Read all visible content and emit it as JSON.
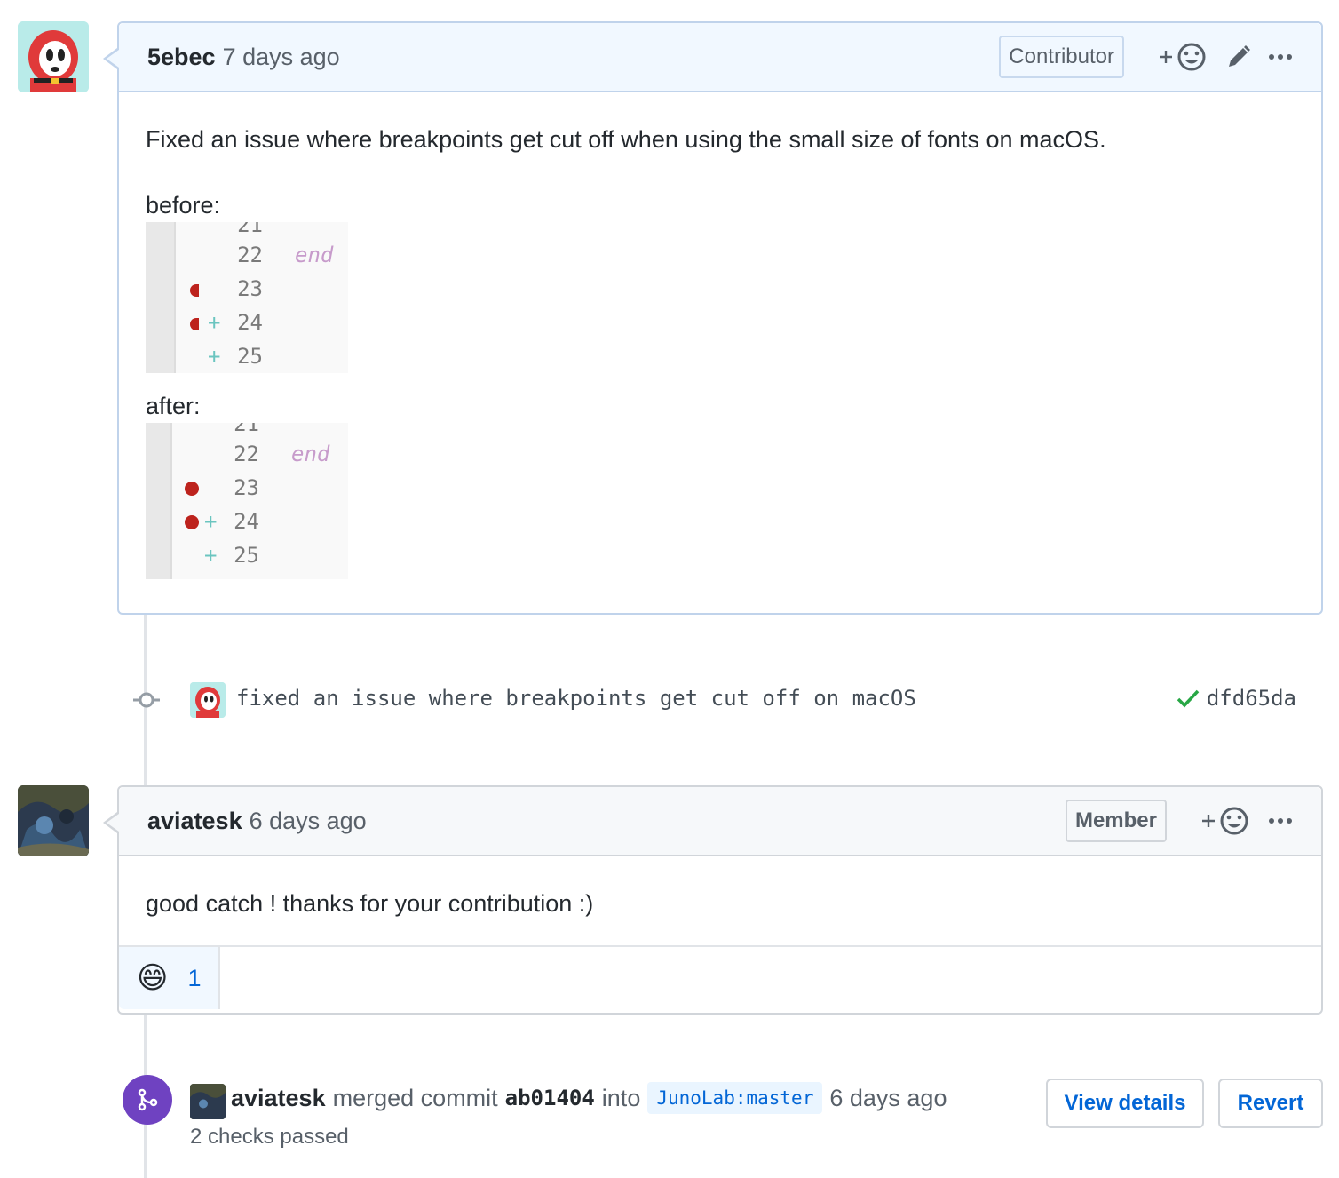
{
  "comments": [
    {
      "author": "5ebec",
      "time": "7 days ago",
      "role": "Contributor",
      "body_line1": "Fixed an issue where breakpoints get cut off when using the small size of fonts on macOS.",
      "label_before": "before:",
      "label_after": "after:",
      "before_lines": {
        "top_partial": "21",
        "l22": "22",
        "l23": "23",
        "l24": "24",
        "l25": "25",
        "kw": "end",
        "plus": "+"
      },
      "after_lines": {
        "top_partial": "21",
        "l22": "22",
        "l23": "23",
        "l24": "24",
        "l25": "25",
        "kw": "end",
        "plus": "+"
      }
    },
    {
      "author": "aviatesk",
      "time": "6 days ago",
      "role": "Member",
      "body": "good catch ! thanks for your contribution :)",
      "reaction_emoji": "😄",
      "reaction_count": "1"
    }
  ],
  "commit": {
    "message": "fixed an issue where breakpoints get cut off on macOS",
    "sha": "dfd65da",
    "status_color": "#28a745"
  },
  "merge": {
    "actor": "aviatesk",
    "text_merged": "merged commit",
    "sha": "ab01404",
    "text_into": "into",
    "branch": "JunoLab:master",
    "time": "6 days ago",
    "checks": "2 checks passed",
    "view_details": "View details",
    "revert": "Revert",
    "icon_color": "#6f42c1"
  },
  "icons": {
    "add_reaction": "+",
    "more": "more-icon",
    "edit": "pencil-icon",
    "smiley": "smiley-icon"
  }
}
